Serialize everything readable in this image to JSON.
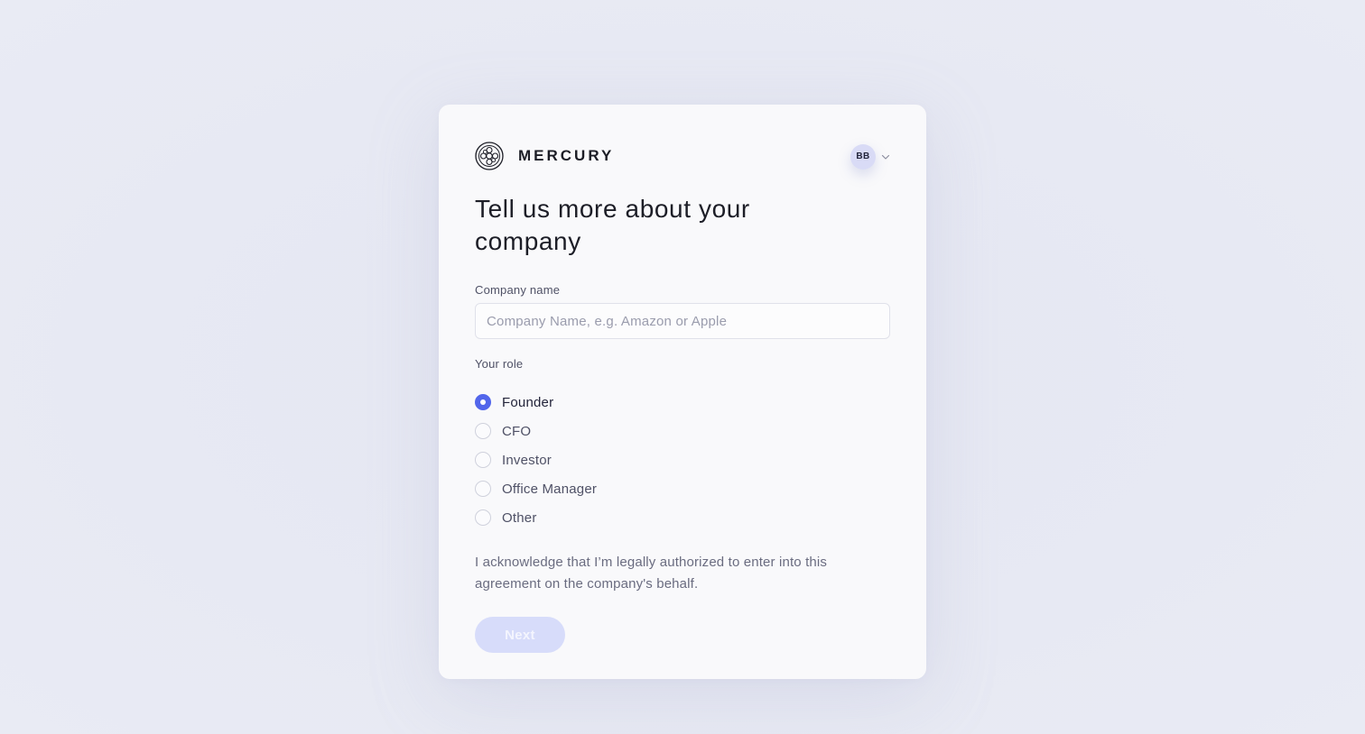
{
  "brand": {
    "name": "MERCURY",
    "logo_icon": "mercury-logo-icon"
  },
  "account": {
    "initials": "BB",
    "menu_icon": "chevron-down-icon"
  },
  "form": {
    "title": "Tell us more about your company",
    "company_name": {
      "label": "Company name",
      "value": "",
      "placeholder": "Company Name, e.g. Amazon or Apple"
    },
    "role": {
      "label": "Your role",
      "options": [
        {
          "label": "Founder",
          "selected": true
        },
        {
          "label": "CFO",
          "selected": false
        },
        {
          "label": "Investor",
          "selected": false
        },
        {
          "label": "Office Manager",
          "selected": false
        },
        {
          "label": "Other",
          "selected": false
        }
      ]
    },
    "acknowledgement": "I acknowledge that I’m legally authorized to enter into this agreement on the company's behalf.",
    "next_label": "Next"
  },
  "colors": {
    "accent": "#5266eb",
    "button_disabled_bg": "#d7dcfa",
    "avatar_bg": "#d9dbf6",
    "page_bg": "#e7e9f3",
    "card_bg": "#f9f9fb"
  }
}
